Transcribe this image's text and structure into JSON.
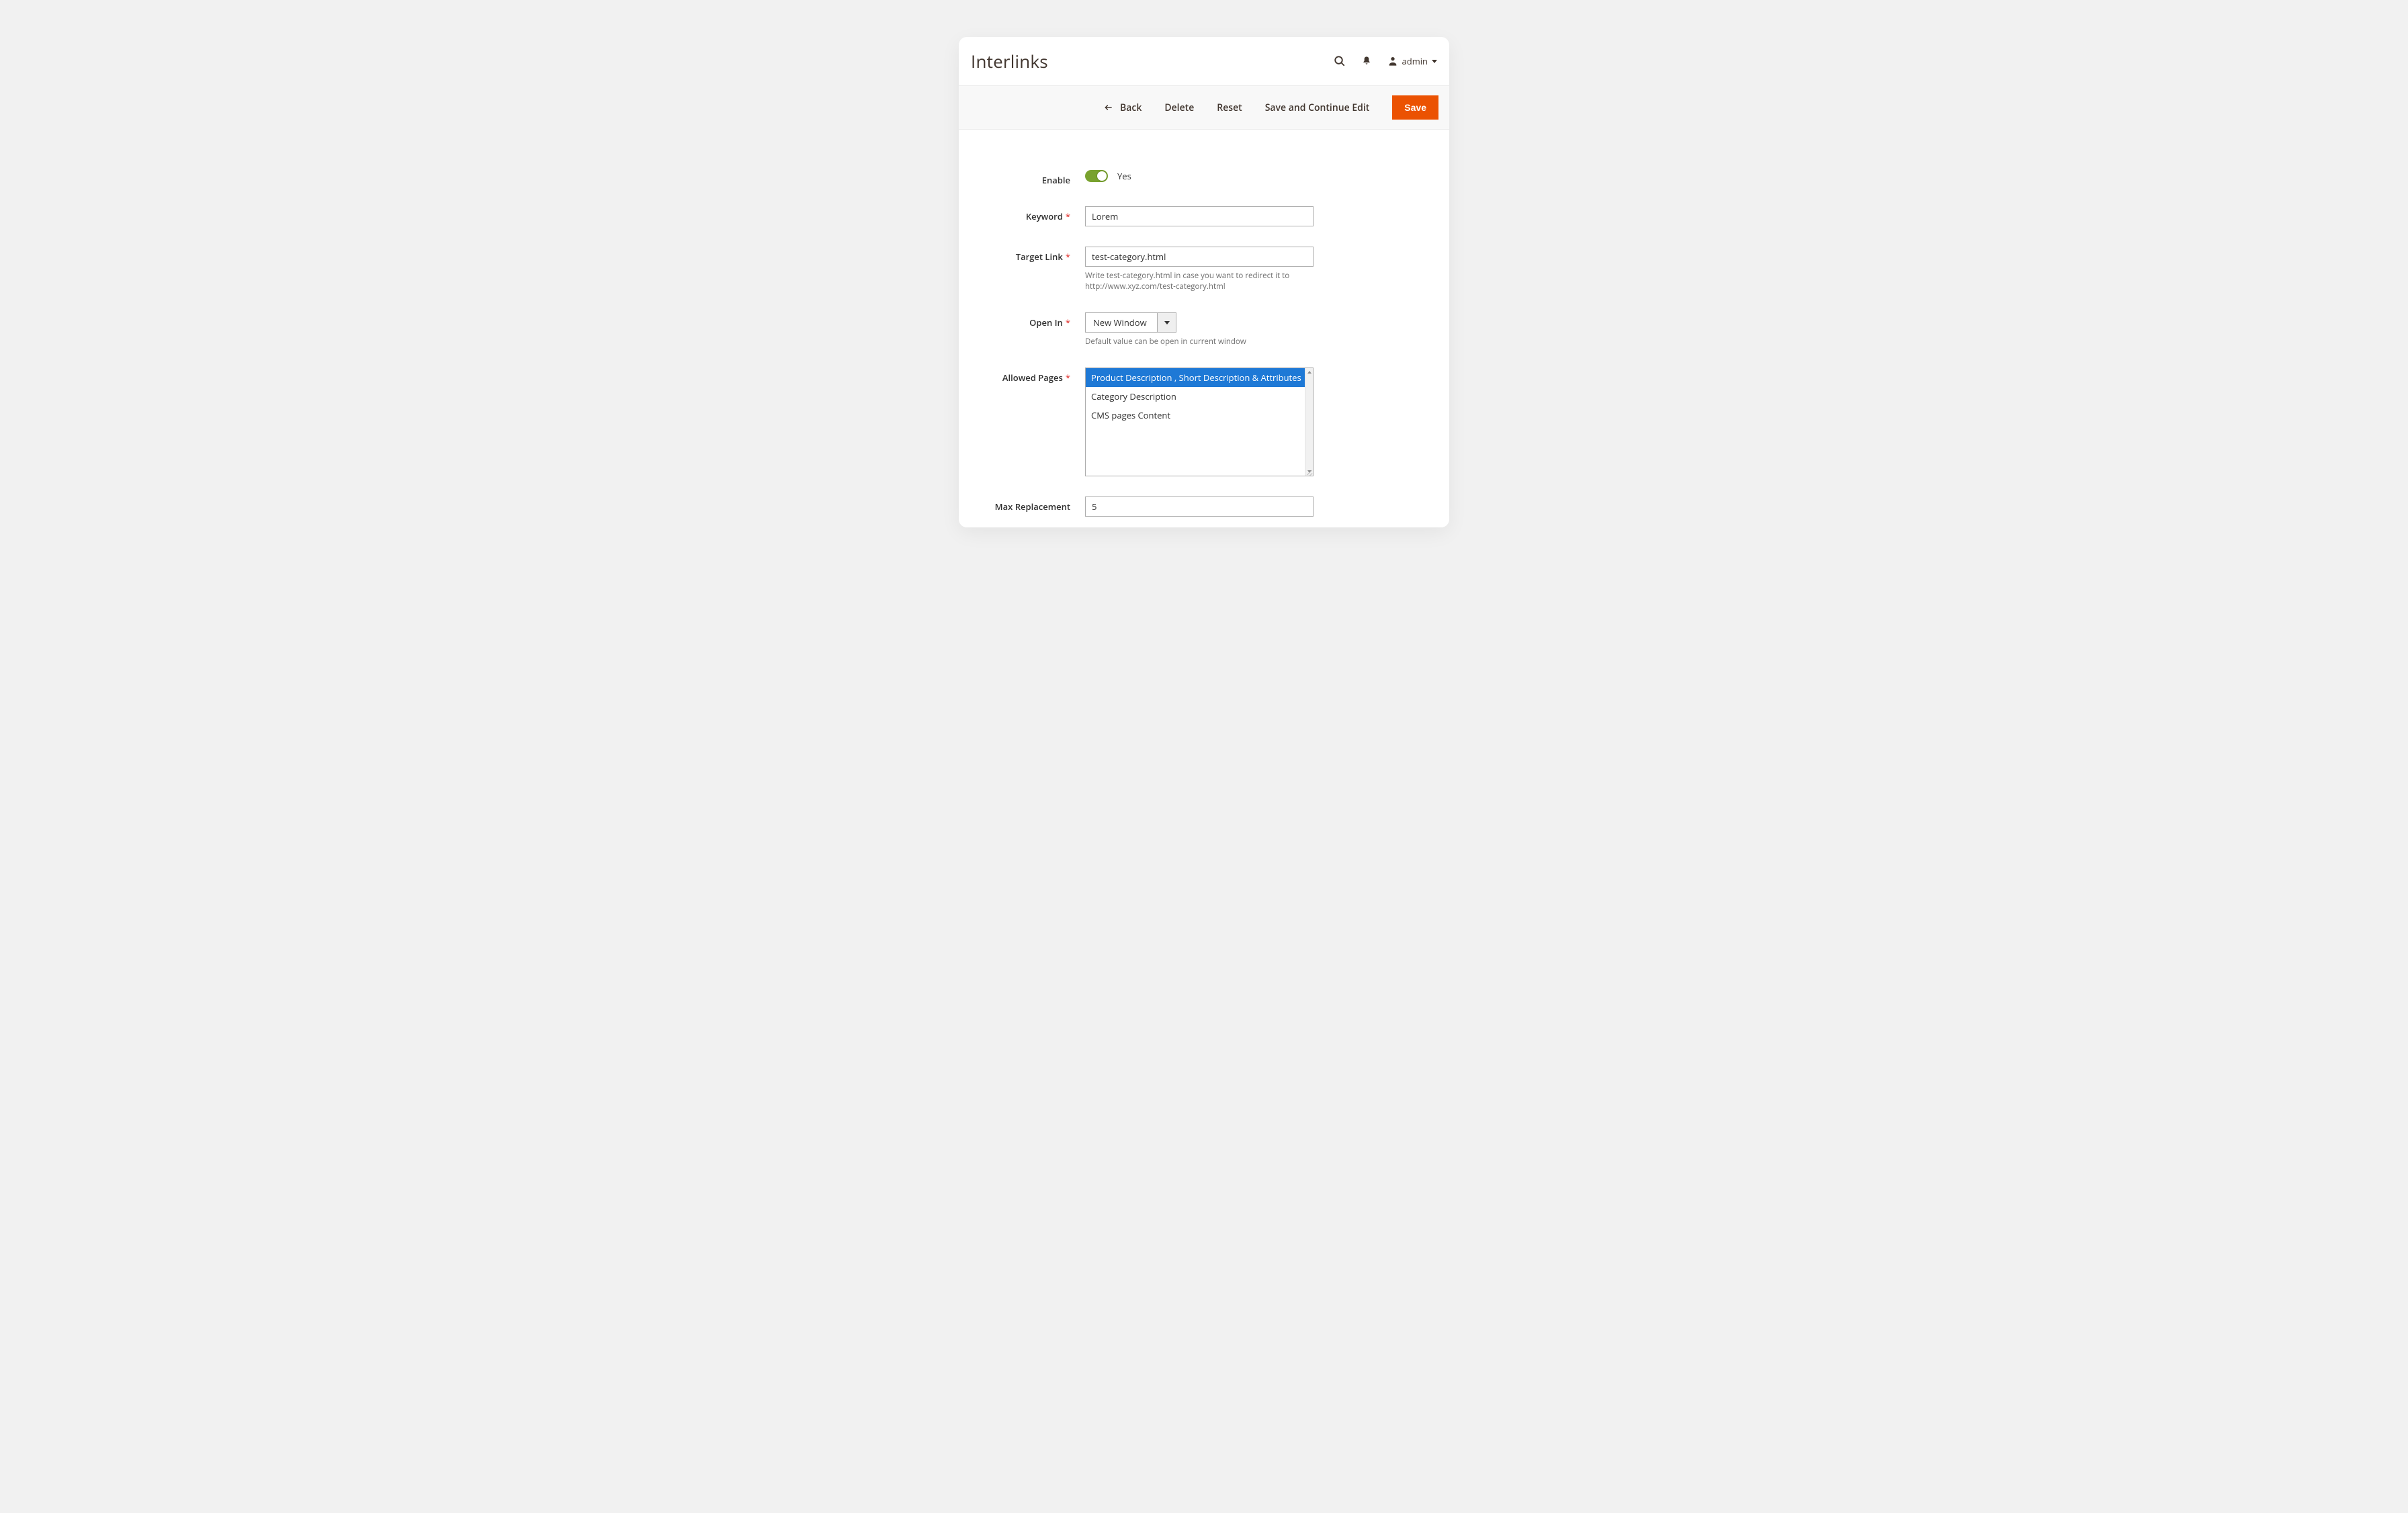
{
  "header": {
    "title": "Interlinks",
    "user": "admin"
  },
  "actions": {
    "back": "Back",
    "delete": "Delete",
    "reset": "Reset",
    "save_continue": "Save and Continue Edit",
    "save": "Save"
  },
  "form": {
    "enable": {
      "label": "Enable",
      "value_text": "Yes"
    },
    "keyword": {
      "label": "Keyword",
      "value": "Lorem"
    },
    "target_link": {
      "label": "Target Link",
      "value": "test-category.html",
      "hint": "Write test-category.html in case you want to redirect it to http://www.xyz.com/test-category.html"
    },
    "open_in": {
      "label": "Open In",
      "value": "New Window",
      "hint": "Default value can be open in current window"
    },
    "allowed_pages": {
      "label": "Allowed Pages",
      "options": [
        "Product Description , Short Description & Attributes",
        "Category Description",
        "CMS pages Content"
      ]
    },
    "max_replacement": {
      "label": "Max Replacement",
      "value": "5"
    }
  }
}
